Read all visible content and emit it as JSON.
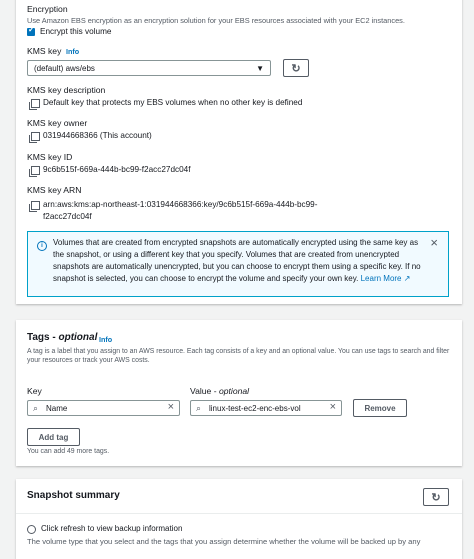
{
  "encryption": {
    "heading": "Encryption",
    "description": "Use Amazon EBS encryption as an encryption solution for your EBS resources associated with your EC2 instances.",
    "checkbox_label": "Encrypt this volume",
    "checked": true
  },
  "kms_key": {
    "label": "KMS key",
    "info": "Info",
    "selected": "(default) aws/ebs",
    "description_label": "KMS key description",
    "description_value": "Default key that protects my EBS volumes when no other key is defined",
    "owner_label": "KMS key owner",
    "owner_value": "031944668366 (This account)",
    "id_label": "KMS key ID",
    "id_value": "9c6b515f-669a-444b-bc99-f2acc27dc04f",
    "arn_label": "KMS key ARN",
    "arn_line1": "arn:aws:kms:ap-northeast-1:031944668366:key/9c6b515f-669a-444b-bc99-",
    "arn_line2": "f2acc27dc04f"
  },
  "alert": {
    "line1": "Volumes that are created from encrypted snapshots are automatically encrypted using the same key as",
    "line2": "the snapshot, or using a different key that you specify. Volumes that are created from unencrypted",
    "line3": "snapshots are automatically unencrypted, but you can choose to encrypt them using a specific key. If no",
    "line4": "snapshot is selected, you can choose to encrypt the volume and specify your own key.",
    "link": "Learn More"
  },
  "tags": {
    "title": "Tags - ",
    "title_optional": "optional",
    "info": "Info",
    "description_line1": "A tag is a label that you assign to an AWS resource. Each tag consists of a key and an optional value. You can use tags to search and filter",
    "description_line2": "your resources or track your AWS costs.",
    "key_header": "Key",
    "value_header": "Value - ",
    "value_header_optional": "optional",
    "rows": [
      {
        "key": "Name",
        "value": "linux-test-ec2-enc-ebs-vol"
      }
    ],
    "remove_label": "Remove",
    "add_label": "Add tag",
    "remaining": "You can add 49 more tags."
  },
  "snapshot": {
    "title": "Snapshot summary",
    "refresh_hint": "Click refresh to view backup information",
    "cut_text": "The volume type that you select and the tags that you assign determine whether the volume will be backed up by any"
  },
  "colors": {
    "link": "#0073bb",
    "accent": "#0073bb",
    "alert_bg": "#f1faff"
  }
}
